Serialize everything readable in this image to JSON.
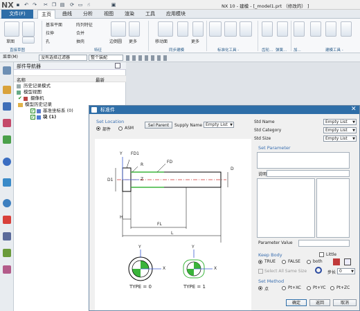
{
  "app": {
    "logo": "NX",
    "title": "NX 10 - 建模 - [_model1.prt （修改的） ]"
  },
  "menu": {
    "file": "文件(F)",
    "tabs": [
      "主页",
      "曲线",
      "分析",
      "视图",
      "渲染",
      "工具",
      "应用模块"
    ]
  },
  "ribbon": {
    "groups": [
      {
        "label": "直接草图"
      },
      {
        "label": "特征"
      },
      {
        "label": "同步建模"
      },
      {
        "label": "标准化工具 -"
      },
      {
        "label": "齿轮..."
      },
      {
        "label": "弹簧..."
      },
      {
        "label": "加..."
      },
      {
        "label": "建模工具 -"
      }
    ],
    "items": {
      "sketch": "草图",
      "datum_plane": "基准平面",
      "array": "阵列特征",
      "pull": "拉伸",
      "merge": "合并",
      "hole": "孔",
      "shell": "抽壳",
      "edge": "边倒圆",
      "more": "更多",
      "move_face": "移动面",
      "more2": "更多"
    }
  },
  "toolbar2": {
    "menu": "菜单(M)",
    "filter": "没有选择过滤器",
    "scope": "整个装配"
  },
  "nav": {
    "title": "部件导航器",
    "col_name": "名称",
    "col_latest": "最新",
    "rows": [
      {
        "label": "历史记录模式"
      },
      {
        "label": "模型视图"
      },
      {
        "label": "摄像机"
      },
      {
        "label": "模型历史记录"
      },
      {
        "label": "基准坐标系 (0)"
      },
      {
        "label": "块 (1)"
      }
    ]
  },
  "dialog": {
    "title": "标准件",
    "set_location": "Set Location",
    "radio_part": "部件",
    "radio_asm": "ASM",
    "sel_parent": "Sel Parent",
    "supply_name": "Supply Name",
    "supply_value": "Empty List",
    "std_name_label": "Std Name",
    "std_name_value": "Empty List",
    "std_category_label": "Std Category",
    "std_category_value": "Empty List",
    "std_size_label": "Std Size",
    "std_size_value": "Empty List",
    "set_parameter": "Set Parameter",
    "description_label": "说明",
    "param_value_label": "Parameter Value",
    "keep_body": "Keep Body",
    "little": "Little",
    "kb_true": "TRUE",
    "kb_false": "FALSE",
    "kb_both": "both",
    "select_all": "Select All Same Size",
    "step_label": "步长",
    "step_value": "0",
    "set_method": "Set Method",
    "m_point": "点",
    "m_xc": "Pt+XC",
    "m_yc": "Pt+YC",
    "m_zc": "Pt+ZC",
    "ok": "确定",
    "back": "返回",
    "cancel": "取消",
    "drawing": {
      "fd1": "FD1",
      "r": "R",
      "fd": "FD",
      "d": "D",
      "d1": "D1",
      "z": "Z",
      "h": "H",
      "fl": "FL",
      "l": "L",
      "y": "Y",
      "x": "X",
      "type0": "TYPE = 0",
      "type1": "TYPE = 1"
    }
  }
}
